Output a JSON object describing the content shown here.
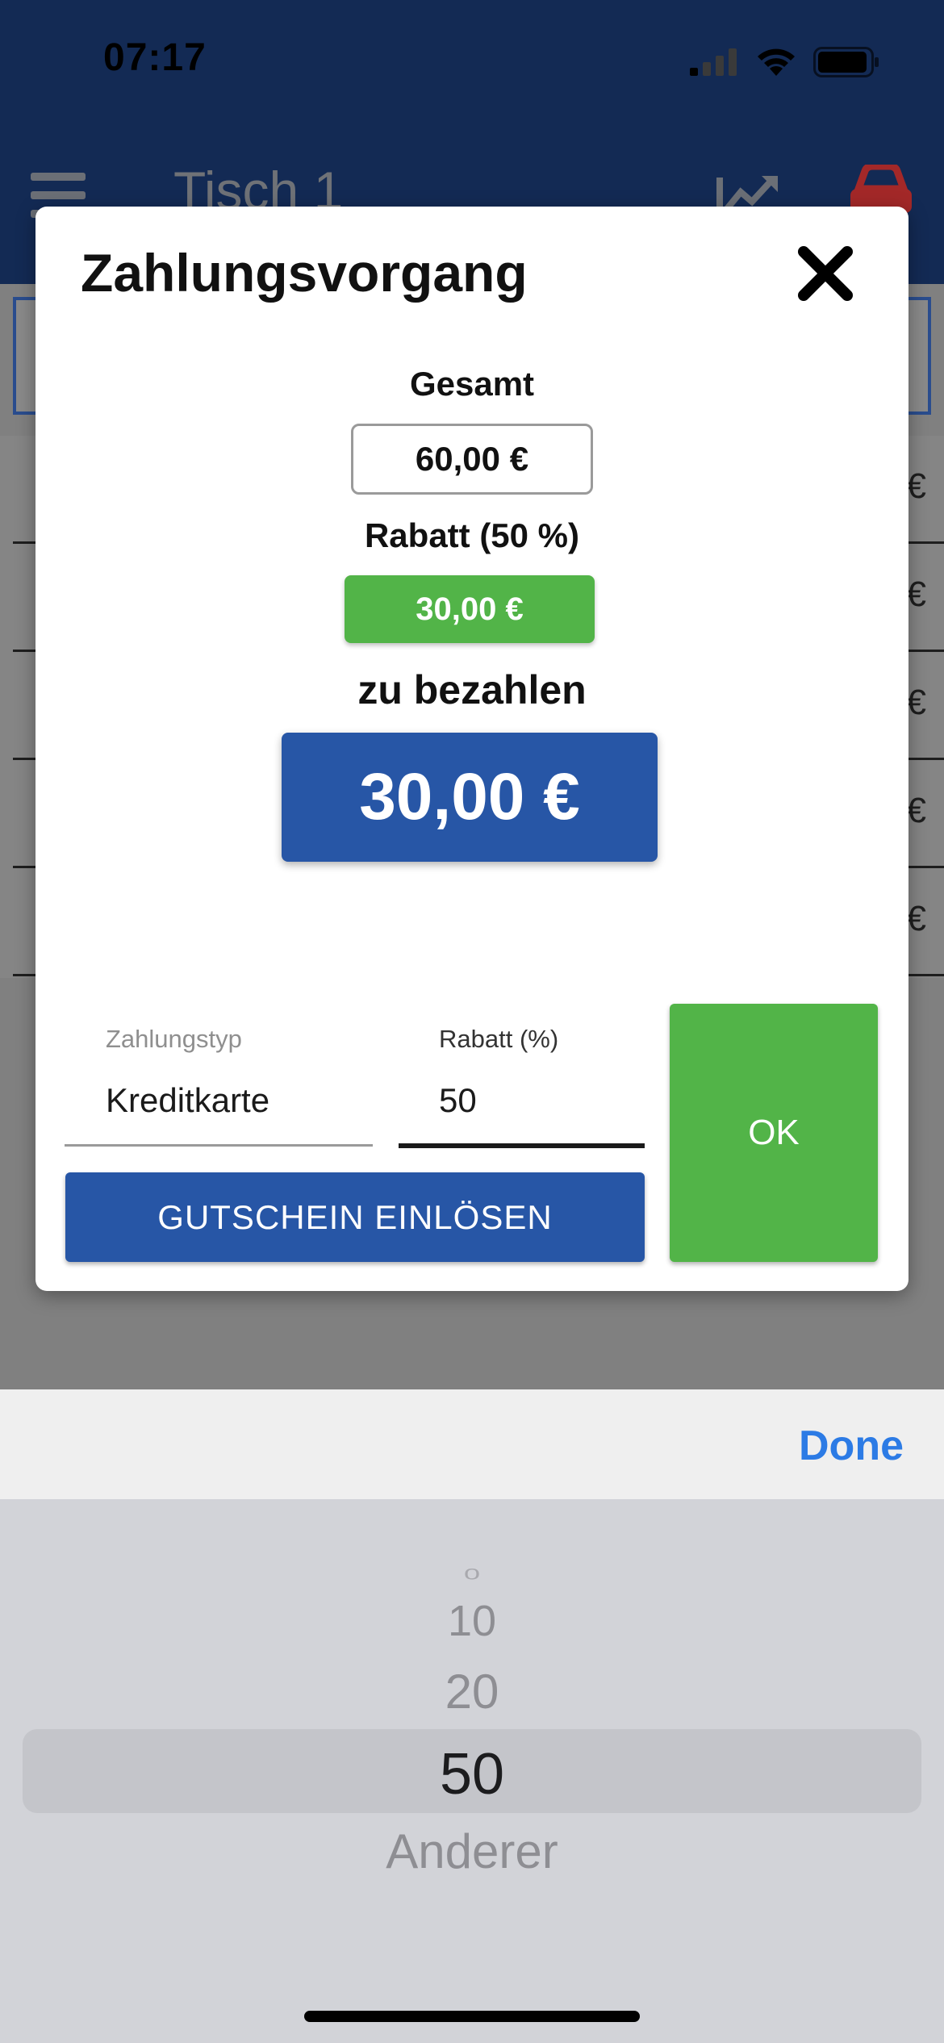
{
  "status_bar": {
    "time": "07:17"
  },
  "header": {
    "title": "Tisch 1"
  },
  "background_table": {
    "rows": [
      "€",
      "€",
      "€",
      "€",
      "€"
    ]
  },
  "modal": {
    "title": "Zahlungsvorgang",
    "gesamt_label": "Gesamt",
    "gesamt_value": "60,00 €",
    "rabatt_label": "Rabatt (50 %)",
    "rabatt_value": "30,00 €",
    "zu_bezahlen_label": "zu bezahlen",
    "zu_bezahlen_value": "30,00 €",
    "zahlungstyp_label": "Zahlungstyp",
    "zahlungstyp_value": "Kreditkarte",
    "rabatt_field_label": "Rabatt (%)",
    "rabatt_field_value": "50",
    "voucher_button": "GUTSCHEIN EINLÖSEN",
    "ok_button": "OK"
  },
  "picker": {
    "done_label": "Done",
    "options": [
      "0",
      "10",
      "20",
      "50",
      "Anderer"
    ],
    "selected": "50"
  },
  "colors": {
    "header_bg": "#132a54",
    "primary_blue": "#2756a6",
    "success_green": "#52b448",
    "done_blue": "#2c7be5",
    "car_red": "#a32828"
  }
}
